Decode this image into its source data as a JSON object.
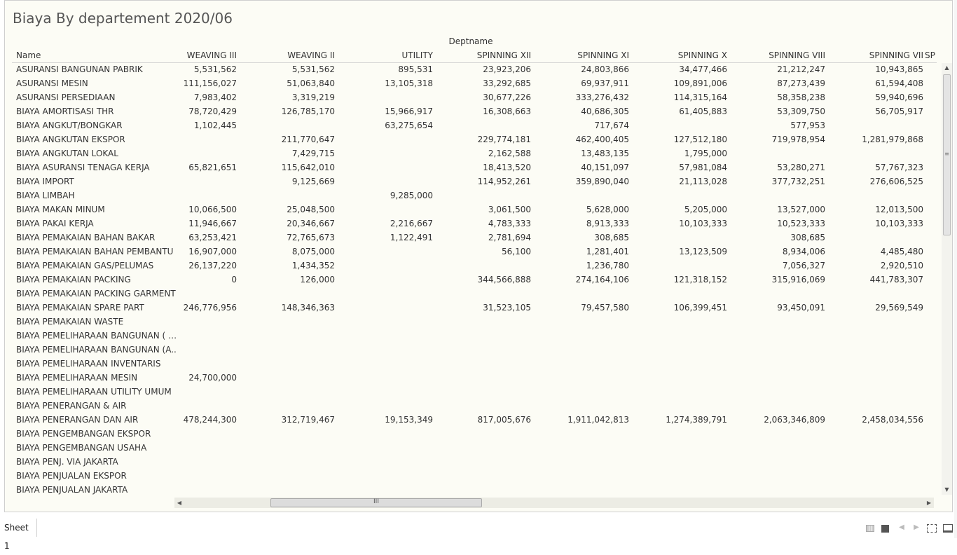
{
  "title": "Biaya By departement 2020/06",
  "column_group_label": "Deptname",
  "name_header": "Name",
  "columns": [
    "WEAVING III",
    "WEAVING II",
    "UTILITY",
    "SPINNING XII",
    "SPINNING XI",
    "SPINNING X",
    "SPINNING VIII",
    "SPINNING VII"
  ],
  "truncated_column": "SP",
  "rows": [
    {
      "name": "ASURANSI BANGUNAN PABRIK",
      "values": [
        "5,531,562",
        "5,531,562",
        "895,531",
        "23,923,206",
        "24,803,866",
        "34,477,466",
        "21,212,247",
        "10,943,865"
      ]
    },
    {
      "name": "ASURANSI MESIN",
      "values": [
        "111,156,027",
        "51,063,840",
        "13,105,318",
        "33,292,685",
        "69,937,911",
        "109,891,006",
        "87,273,439",
        "61,594,408"
      ]
    },
    {
      "name": "ASURANSI PERSEDIAAN",
      "values": [
        "7,983,402",
        "3,319,219",
        "",
        "30,677,226",
        "333,276,432",
        "114,315,164",
        "58,358,238",
        "59,940,696"
      ]
    },
    {
      "name": "BIAYA AMORTISASI THR",
      "values": [
        "78,720,429",
        "126,785,170",
        "15,966,917",
        "16,308,663",
        "40,686,305",
        "61,405,883",
        "53,309,750",
        "56,705,917"
      ]
    },
    {
      "name": "BIAYA ANGKUT/BONGKAR",
      "values": [
        "1,102,445",
        "",
        "63,275,654",
        "",
        "717,674",
        "",
        "577,953",
        ""
      ]
    },
    {
      "name": "BIAYA ANGKUTAN EKSPOR",
      "values": [
        "",
        "211,770,647",
        "",
        "229,774,181",
        "462,400,405",
        "127,512,180",
        "719,978,954",
        "1,281,979,868"
      ]
    },
    {
      "name": "BIAYA ANGKUTAN LOKAL",
      "values": [
        "",
        "7,429,715",
        "",
        "2,162,588",
        "13,483,135",
        "1,795,000",
        "",
        ""
      ]
    },
    {
      "name": "BIAYA ASURANSI TENAGA KERJA",
      "values": [
        "65,821,651",
        "115,642,010",
        "",
        "18,413,520",
        "40,151,097",
        "57,981,084",
        "53,280,271",
        "57,767,323"
      ]
    },
    {
      "name": "BIAYA IMPORT",
      "values": [
        "",
        "9,125,669",
        "",
        "114,952,261",
        "359,890,040",
        "21,113,028",
        "377,732,251",
        "276,606,525"
      ]
    },
    {
      "name": "BIAYA LIMBAH",
      "values": [
        "",
        "",
        "9,285,000",
        "",
        "",
        "",
        "",
        ""
      ]
    },
    {
      "name": "BIAYA MAKAN MINUM",
      "values": [
        "10,066,500",
        "25,048,500",
        "",
        "3,061,500",
        "5,628,000",
        "5,205,000",
        "13,527,000",
        "12,013,500"
      ]
    },
    {
      "name": "BIAYA PAKAI KERJA",
      "values": [
        "11,946,667",
        "20,346,667",
        "2,216,667",
        "4,783,333",
        "8,913,333",
        "10,103,333",
        "10,523,333",
        "10,103,333"
      ]
    },
    {
      "name": "BIAYA PEMAKAIAN BAHAN BAKAR",
      "values": [
        "63,253,421",
        "72,765,673",
        "1,122,491",
        "2,781,694",
        "308,685",
        "",
        "308,685",
        ""
      ]
    },
    {
      "name": "BIAYA PEMAKAIAN BAHAN PEMBANTU",
      "values": [
        "16,907,000",
        "8,075,000",
        "",
        "56,100",
        "1,281,401",
        "13,123,509",
        "8,934,006",
        "4,485,480"
      ]
    },
    {
      "name": "BIAYA PEMAKAIAN GAS/PELUMAS",
      "values": [
        "26,137,220",
        "1,434,352",
        "",
        "",
        "1,236,780",
        "",
        "7,056,327",
        "2,920,510"
      ]
    },
    {
      "name": "BIAYA PEMAKAIAN PACKING",
      "values": [
        "0",
        "126,000",
        "",
        "344,566,888",
        "274,164,106",
        "121,318,152",
        "315,916,069",
        "441,783,307"
      ]
    },
    {
      "name": "BIAYA PEMAKAIAN PACKING GARMENT",
      "values": [
        "",
        "",
        "",
        "",
        "",
        "",
        "",
        ""
      ]
    },
    {
      "name": "BIAYA PEMAKAIAN SPARE PART",
      "values": [
        "246,776,956",
        "148,346,363",
        "",
        "31,523,105",
        "79,457,580",
        "106,399,451",
        "93,450,091",
        "29,569,549"
      ]
    },
    {
      "name": "BIAYA PEMAKAIAN WASTE",
      "values": [
        "",
        "",
        "",
        "",
        "",
        "",
        "",
        ""
      ]
    },
    {
      "name": "BIAYA PEMELIHARAAN BANGUNAN ( O..",
      "values": [
        "",
        "",
        "",
        "",
        "",
        "",
        "",
        ""
      ]
    },
    {
      "name": "BIAYA PEMELIHARAAN BANGUNAN (A..",
      "values": [
        "",
        "",
        "",
        "",
        "",
        "",
        "",
        ""
      ]
    },
    {
      "name": "BIAYA PEMELIHARAAN INVENTARIS",
      "values": [
        "",
        "",
        "",
        "",
        "",
        "",
        "",
        ""
      ]
    },
    {
      "name": "BIAYA PEMELIHARAAN MESIN",
      "values": [
        "24,700,000",
        "",
        "",
        "",
        "",
        "",
        "",
        ""
      ]
    },
    {
      "name": "BIAYA PEMELIHARAAN UTILITY UMUM",
      "values": [
        "",
        "",
        "",
        "",
        "",
        "",
        "",
        ""
      ]
    },
    {
      "name": "BIAYA PENERANGAN & AIR",
      "values": [
        "",
        "",
        "",
        "",
        "",
        "",
        "",
        ""
      ]
    },
    {
      "name": "BIAYA PENERANGAN DAN AIR",
      "values": [
        "478,244,300",
        "312,719,467",
        "19,153,349",
        "817,005,676",
        "1,911,042,813",
        "1,274,389,791",
        "2,063,346,809",
        "2,458,034,556"
      ]
    },
    {
      "name": "BIAYA PENGEMBANGAN EKSPOR",
      "values": [
        "",
        "",
        "",
        "",
        "",
        "",
        "",
        ""
      ]
    },
    {
      "name": "BIAYA PENGEMBANGAN USAHA",
      "values": [
        "",
        "",
        "",
        "",
        "",
        "",
        "",
        ""
      ]
    },
    {
      "name": "BIAYA PENJ. VIA JAKARTA",
      "values": [
        "",
        "",
        "",
        "",
        "",
        "",
        "",
        ""
      ]
    },
    {
      "name": "BIAYA PENJUALAN EKSPOR",
      "values": [
        "",
        "",
        "",
        "",
        "",
        "",
        "",
        ""
      ]
    },
    {
      "name": "BIAYA PENJUALAN JAKARTA",
      "values": [
        "",
        "",
        "",
        "",
        "",
        "",
        "",
        ""
      ]
    }
  ],
  "sheet_tab": "Sheet 1",
  "toolbar_icons": [
    "grid-view-icon",
    "single-view-icon",
    "previous-icon",
    "next-icon",
    "fullscreen-icon",
    "presentation-icon"
  ],
  "scroll_glyphs": {
    "up": "▲",
    "down": "▼",
    "left": "◀",
    "right": "▶",
    "grip_v": "≡",
    "grip_h": "III"
  },
  "nav_glyphs": {
    "prev": "◀",
    "next": "▶"
  }
}
